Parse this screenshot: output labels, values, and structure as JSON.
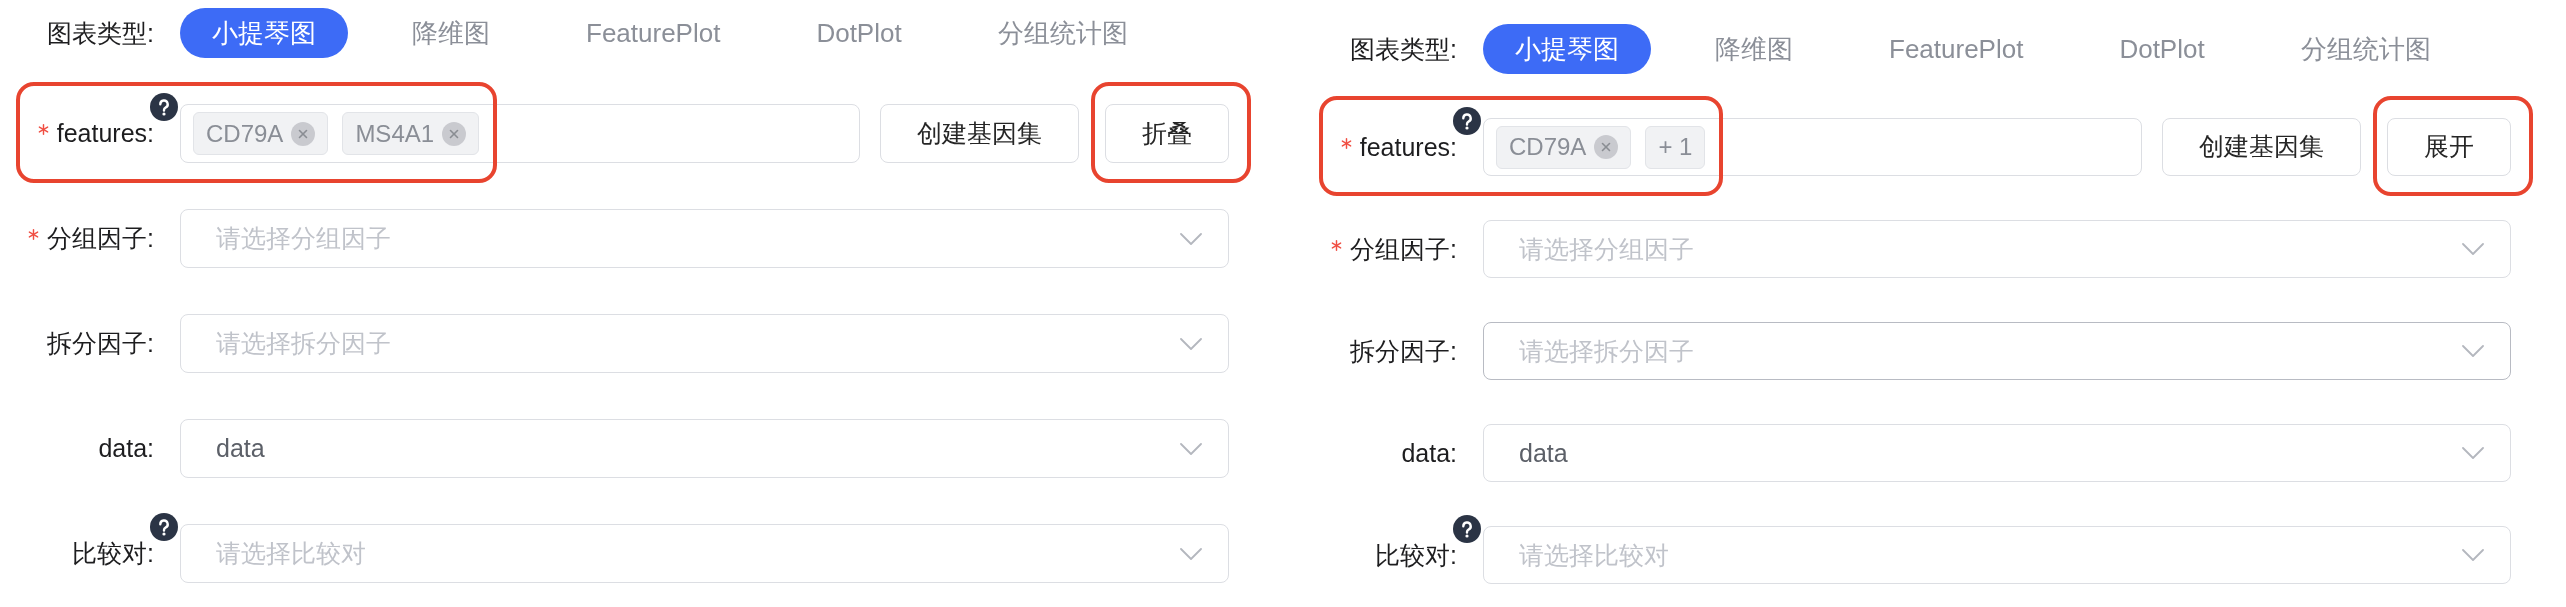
{
  "panels": [
    {
      "chart_type": {
        "label": "图表类型:",
        "tabs": [
          {
            "label": "小提琴图",
            "selected": true
          },
          {
            "label": "降维图",
            "selected": false
          },
          {
            "label": "FeaturePlot",
            "selected": false
          },
          {
            "label": "DotPlot",
            "selected": false
          },
          {
            "label": "分组统计图",
            "selected": false
          }
        ]
      },
      "fields": [
        {
          "kind": "tags",
          "label": "features:",
          "required": true,
          "help": true,
          "hovered": false,
          "highlighted": true,
          "tags": [
            {
              "text": "CD79A",
              "removable": true
            },
            {
              "text": "MS4A1",
              "removable": true
            }
          ],
          "buttons": [
            {
              "label": "创建基因集",
              "highlighted": false
            },
            {
              "label": "折叠",
              "highlighted": true
            }
          ]
        },
        {
          "kind": "select",
          "label": "分组因子:",
          "required": true,
          "help": false,
          "hovered": false,
          "placeholder": "请选择分组因子"
        },
        {
          "kind": "select",
          "label": "拆分因子:",
          "required": false,
          "help": false,
          "hovered": false,
          "placeholder": "请选择拆分因子"
        },
        {
          "kind": "select",
          "label": "data:",
          "required": false,
          "help": false,
          "hovered": false,
          "value": "data"
        },
        {
          "kind": "select",
          "label": "比较对:",
          "required": false,
          "help": true,
          "hovered": false,
          "placeholder": "请选择比较对"
        }
      ]
    },
    {
      "chart_type": {
        "label": "图表类型:",
        "tabs": [
          {
            "label": "小提琴图",
            "selected": true
          },
          {
            "label": "降维图",
            "selected": false
          },
          {
            "label": "FeaturePlot",
            "selected": false
          },
          {
            "label": "DotPlot",
            "selected": false
          },
          {
            "label": "分组统计图",
            "selected": false
          }
        ]
      },
      "fields": [
        {
          "kind": "tags",
          "label": "features:",
          "required": true,
          "help": true,
          "hovered": false,
          "highlighted": true,
          "tags": [
            {
              "text": "CD79A",
              "removable": true
            },
            {
              "text": "+ 1",
              "removable": false
            }
          ],
          "buttons": [
            {
              "label": "创建基因集",
              "highlighted": false
            },
            {
              "label": "展开",
              "highlighted": true
            }
          ]
        },
        {
          "kind": "select",
          "label": "分组因子:",
          "required": true,
          "help": false,
          "hovered": false,
          "placeholder": "请选择分组因子"
        },
        {
          "kind": "select",
          "label": "拆分因子:",
          "required": false,
          "help": false,
          "hovered": true,
          "placeholder": "请选择拆分因子"
        },
        {
          "kind": "select",
          "label": "data:",
          "required": false,
          "help": false,
          "hovered": false,
          "value": "data"
        },
        {
          "kind": "select",
          "label": "比较对:",
          "required": false,
          "help": true,
          "hovered": false,
          "placeholder": "请选择比较对"
        }
      ]
    }
  ]
}
